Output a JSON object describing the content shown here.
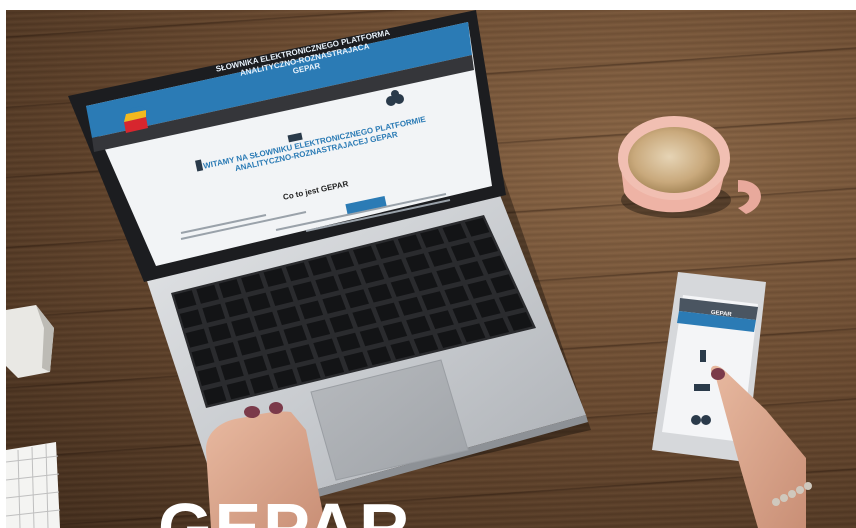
{
  "laptop_site": {
    "header_title_line1": "SŁOWNIKA ELEKTRONICZNEGO PLATFORMA",
    "header_title_line2": "ANALITYCZNO-ROZNASTRAJACA",
    "header_title_line3": "GEPAR",
    "nav_icons": [
      "gear-icon",
      "book-icon",
      "people-icon"
    ],
    "welcome_line1": "WITAMY NA SŁOWNIKU ELEKTRONICZNEGO PLATFORMIE",
    "welcome_line2": "ANALITYCZNO-ROZNASTRAJACEJ GEPAR",
    "section_title": "Co to jest GEPAR",
    "brand_color": "#2b7bb5"
  },
  "phone_site": {
    "title": "GEPAR",
    "icons": [
      "info-icon",
      "dictionary-icon",
      "people-icon"
    ]
  },
  "headline": "GEPAR"
}
